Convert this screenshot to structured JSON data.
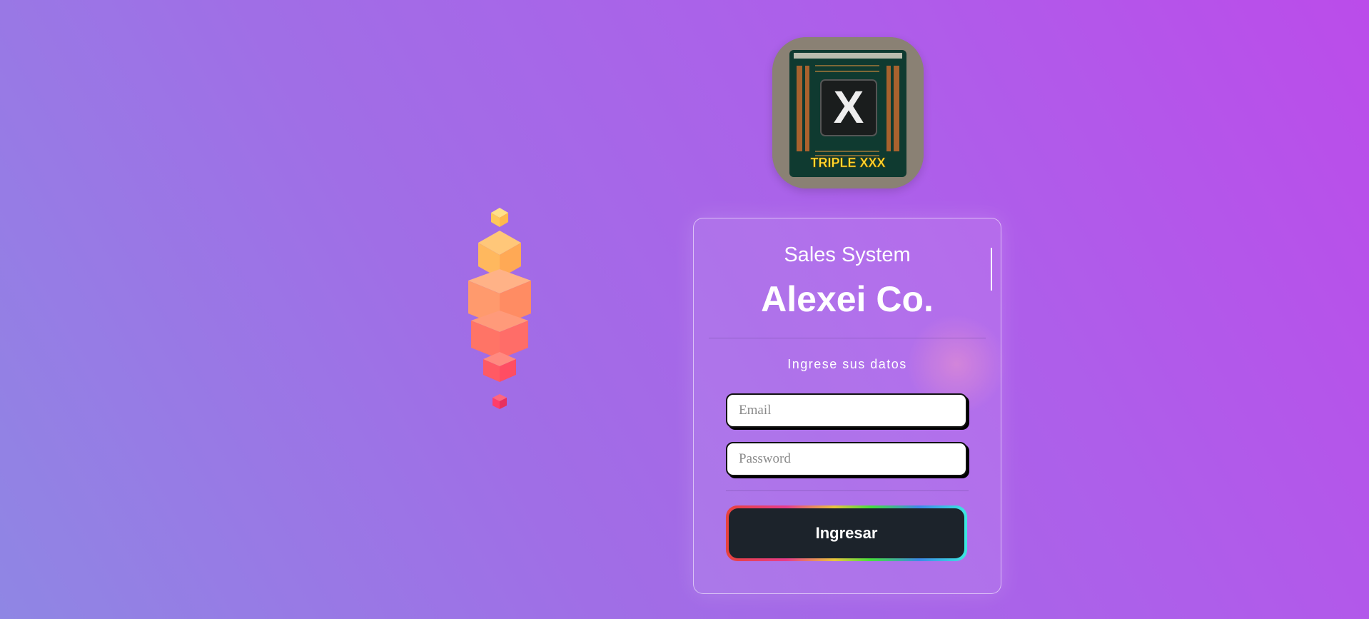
{
  "brand": {
    "logo_text": "TRIPLE XXX",
    "logo_letter": "X"
  },
  "card": {
    "subtitle": "Sales System",
    "title": "Alexei Co.",
    "prompt": "Ingrese sus datos",
    "email_placeholder": "Email",
    "password_placeholder": "Password",
    "submit_label": "Ingresar"
  },
  "colors": {
    "background_start": "#8f86e4",
    "background_end": "#bb4cea",
    "button": "#1c232b",
    "cube_top": "#ffd36b",
    "cube_bottom": "#ff3d6a"
  }
}
